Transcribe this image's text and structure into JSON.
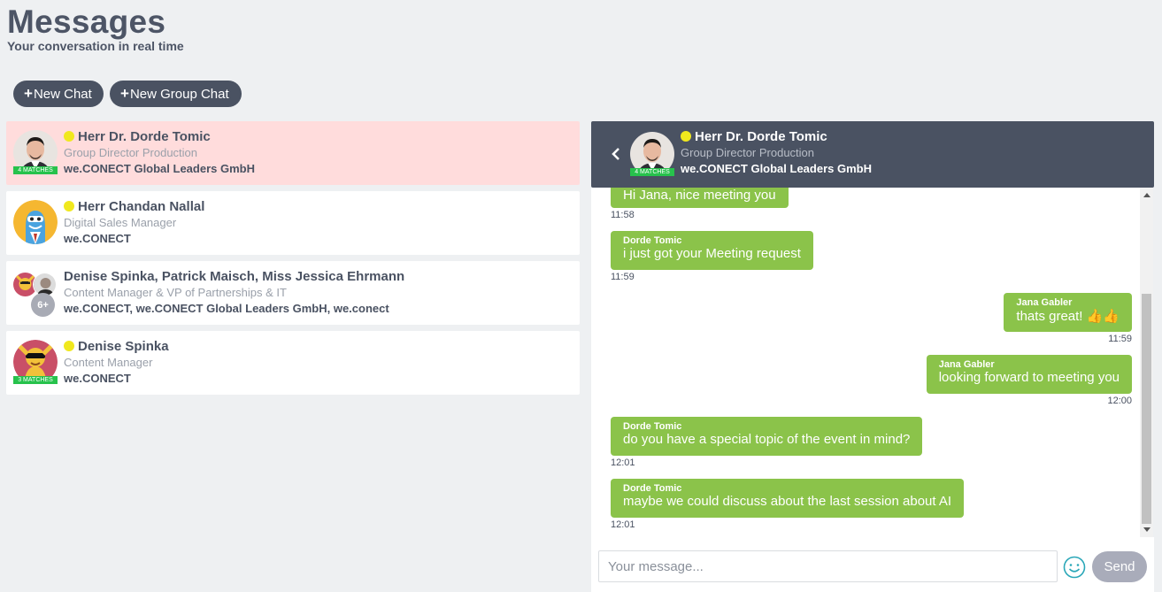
{
  "page": {
    "title": "Messages",
    "subtitle": "Your conversation in real time"
  },
  "toolbar": {
    "new_chat_label": "New Chat",
    "new_group_chat_label": "New Group Chat",
    "plus_symbol": "+"
  },
  "chat_list": [
    {
      "name": "Herr Dr. Dorde Tomic",
      "role": "Group Director Production",
      "company": "we.CONECT Global Leaders GmbH",
      "matches": "4 MATCHES",
      "online": true,
      "active": true
    },
    {
      "name": "Herr Chandan Nallal",
      "role": "Digital Sales Manager",
      "company": "we.CONECT",
      "online": true
    },
    {
      "name": "Denise Spinka, Patrick Maisch, Miss Jessica Ehrmann",
      "role": "Content Manager & VP of Partnerships & IT",
      "company": "we.CONECT, we.CONECT Global Leaders GmbH, we.conect",
      "extra_count": "6+"
    },
    {
      "name": "Denise Spinka",
      "role": "Content Manager",
      "company": "we.CONECT",
      "matches": "3 MATCHES",
      "online": true
    }
  ],
  "conversation": {
    "name": "Herr Dr. Dorde Tomic",
    "role": "Group Director Production",
    "company": "we.CONECT Global Leaders GmbH",
    "matches": "4 MATCHES",
    "messages": [
      {
        "from": "",
        "text": "Hi Jana, nice meeting you",
        "time": "11:58",
        "side": "left"
      },
      {
        "from": "Dorde Tomic",
        "text": "i just got your Meeting request",
        "time": "11:59",
        "side": "left"
      },
      {
        "from": "Jana Gabler",
        "text": "thats great!",
        "time": "11:59",
        "side": "right",
        "emoji": "👍👍"
      },
      {
        "from": "Jana Gabler",
        "text": "looking forward to meeting you",
        "time": "12:00",
        "side": "right"
      },
      {
        "from": "Dorde Tomic",
        "text": "do you have a special topic of the event in mind?",
        "time": "12:01",
        "side": "left"
      },
      {
        "from": "Dorde Tomic",
        "text": "maybe we could discuss about the last session about AI",
        "time": "12:01",
        "side": "left"
      }
    ]
  },
  "composer": {
    "placeholder": "Your message...",
    "send_label": "Send"
  },
  "colors": {
    "header_bg": "#4a5262",
    "message_green": "#8bc34a",
    "active_item": "#ffdcdc",
    "online": "#f0e81e",
    "matches_badge": "#27c24c"
  }
}
